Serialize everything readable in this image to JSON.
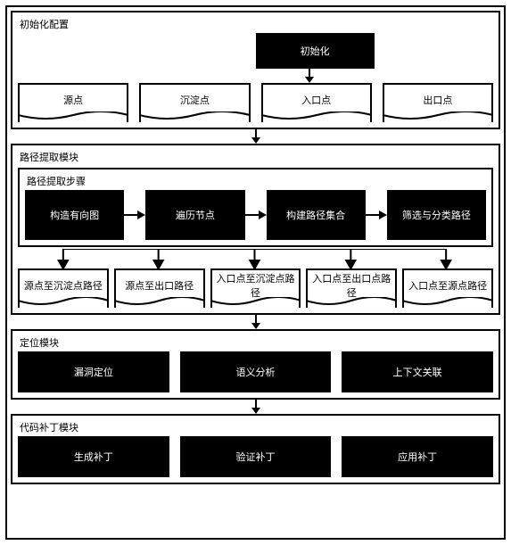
{
  "modules": {
    "init": {
      "title": "初始化配置",
      "top_box": "初始化",
      "docs": [
        "源点",
        "沉淀点",
        "入口点",
        "出口点"
      ]
    },
    "path": {
      "title": "路径提取模块",
      "inner_title": "路径提取步骤",
      "steps": [
        "构造有向图",
        "遍历节点",
        "构建路径集合",
        "筛选与分类路径"
      ],
      "docs": [
        "源点至沉淀点路径",
        "源点至出口路径",
        "入口点至沉淀点路径",
        "入口点至出口点路径",
        "入口点至源点路径"
      ]
    },
    "locate": {
      "title": "定位模块",
      "boxes": [
        "漏洞定位",
        "语义分析",
        "上下文关联"
      ]
    },
    "patch": {
      "title": "代码补丁模块",
      "boxes": [
        "生成补丁",
        "验证补丁",
        "应用补丁"
      ]
    }
  }
}
